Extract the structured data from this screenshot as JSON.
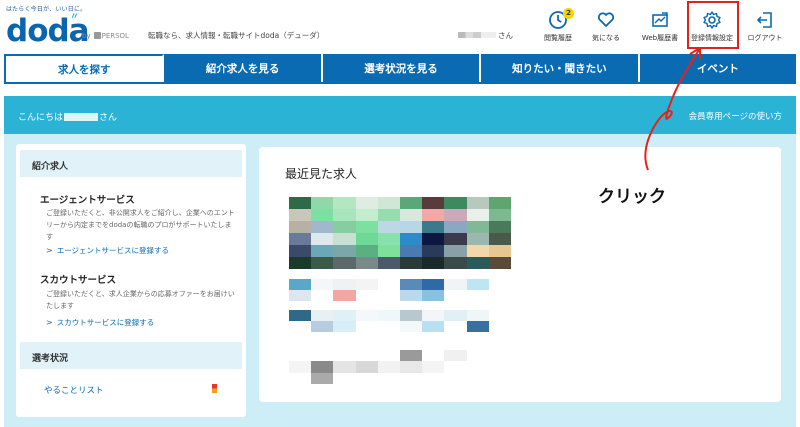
{
  "header": {
    "tagline": "はたらく今日が、いい日に。",
    "logo": "doda",
    "byline_by": "by",
    "byline_brand": "PERSOL",
    "site_copy": "転職なら、求人情報・転職サイトdoda（デューダ）",
    "username_suffix": "さん",
    "nav": [
      {
        "label": "閲覧履歴",
        "icon": "clock-icon",
        "badge": "2"
      },
      {
        "label": "気になる",
        "icon": "heart-icon"
      },
      {
        "label": "Web履歴書",
        "icon": "resume-icon"
      },
      {
        "label": "登録情報設定",
        "icon": "gear-icon"
      },
      {
        "label": "ログアウト",
        "icon": "logout-icon"
      }
    ]
  },
  "tabs": [
    "求人を探す",
    "紹介求人を見る",
    "選考状況を見る",
    "知りたい・聞きたい",
    "イベント"
  ],
  "greeting": {
    "prefix": "こんにちは",
    "suffix": "さん",
    "link": "会員専用ページの使い方"
  },
  "left_panel": {
    "section1": "紹介求人",
    "agent_title": "エージェントサービス",
    "agent_desc": "ご登録いただくと、非公開求人をご紹介し、企業へのエントリーから内定までをdodaの転職のプロがサポートいたします",
    "agent_link": "エージェントサービスに登録する",
    "scout_title": "スカウトサービス",
    "scout_desc": "ご登録いただくと、求人企業からの応募オファーをお届けいたします",
    "scout_link": "スカウトサービスに登録する",
    "section2": "選考状況",
    "todo": "やることリスト"
  },
  "right_panel": {
    "title": "最近見た求人"
  },
  "annotation": {
    "label": "クリック"
  },
  "colors": {
    "brand_blue": "#0a6ab2",
    "greeting_band": "#2bb3d6",
    "highlight_red": "#e0241b"
  }
}
